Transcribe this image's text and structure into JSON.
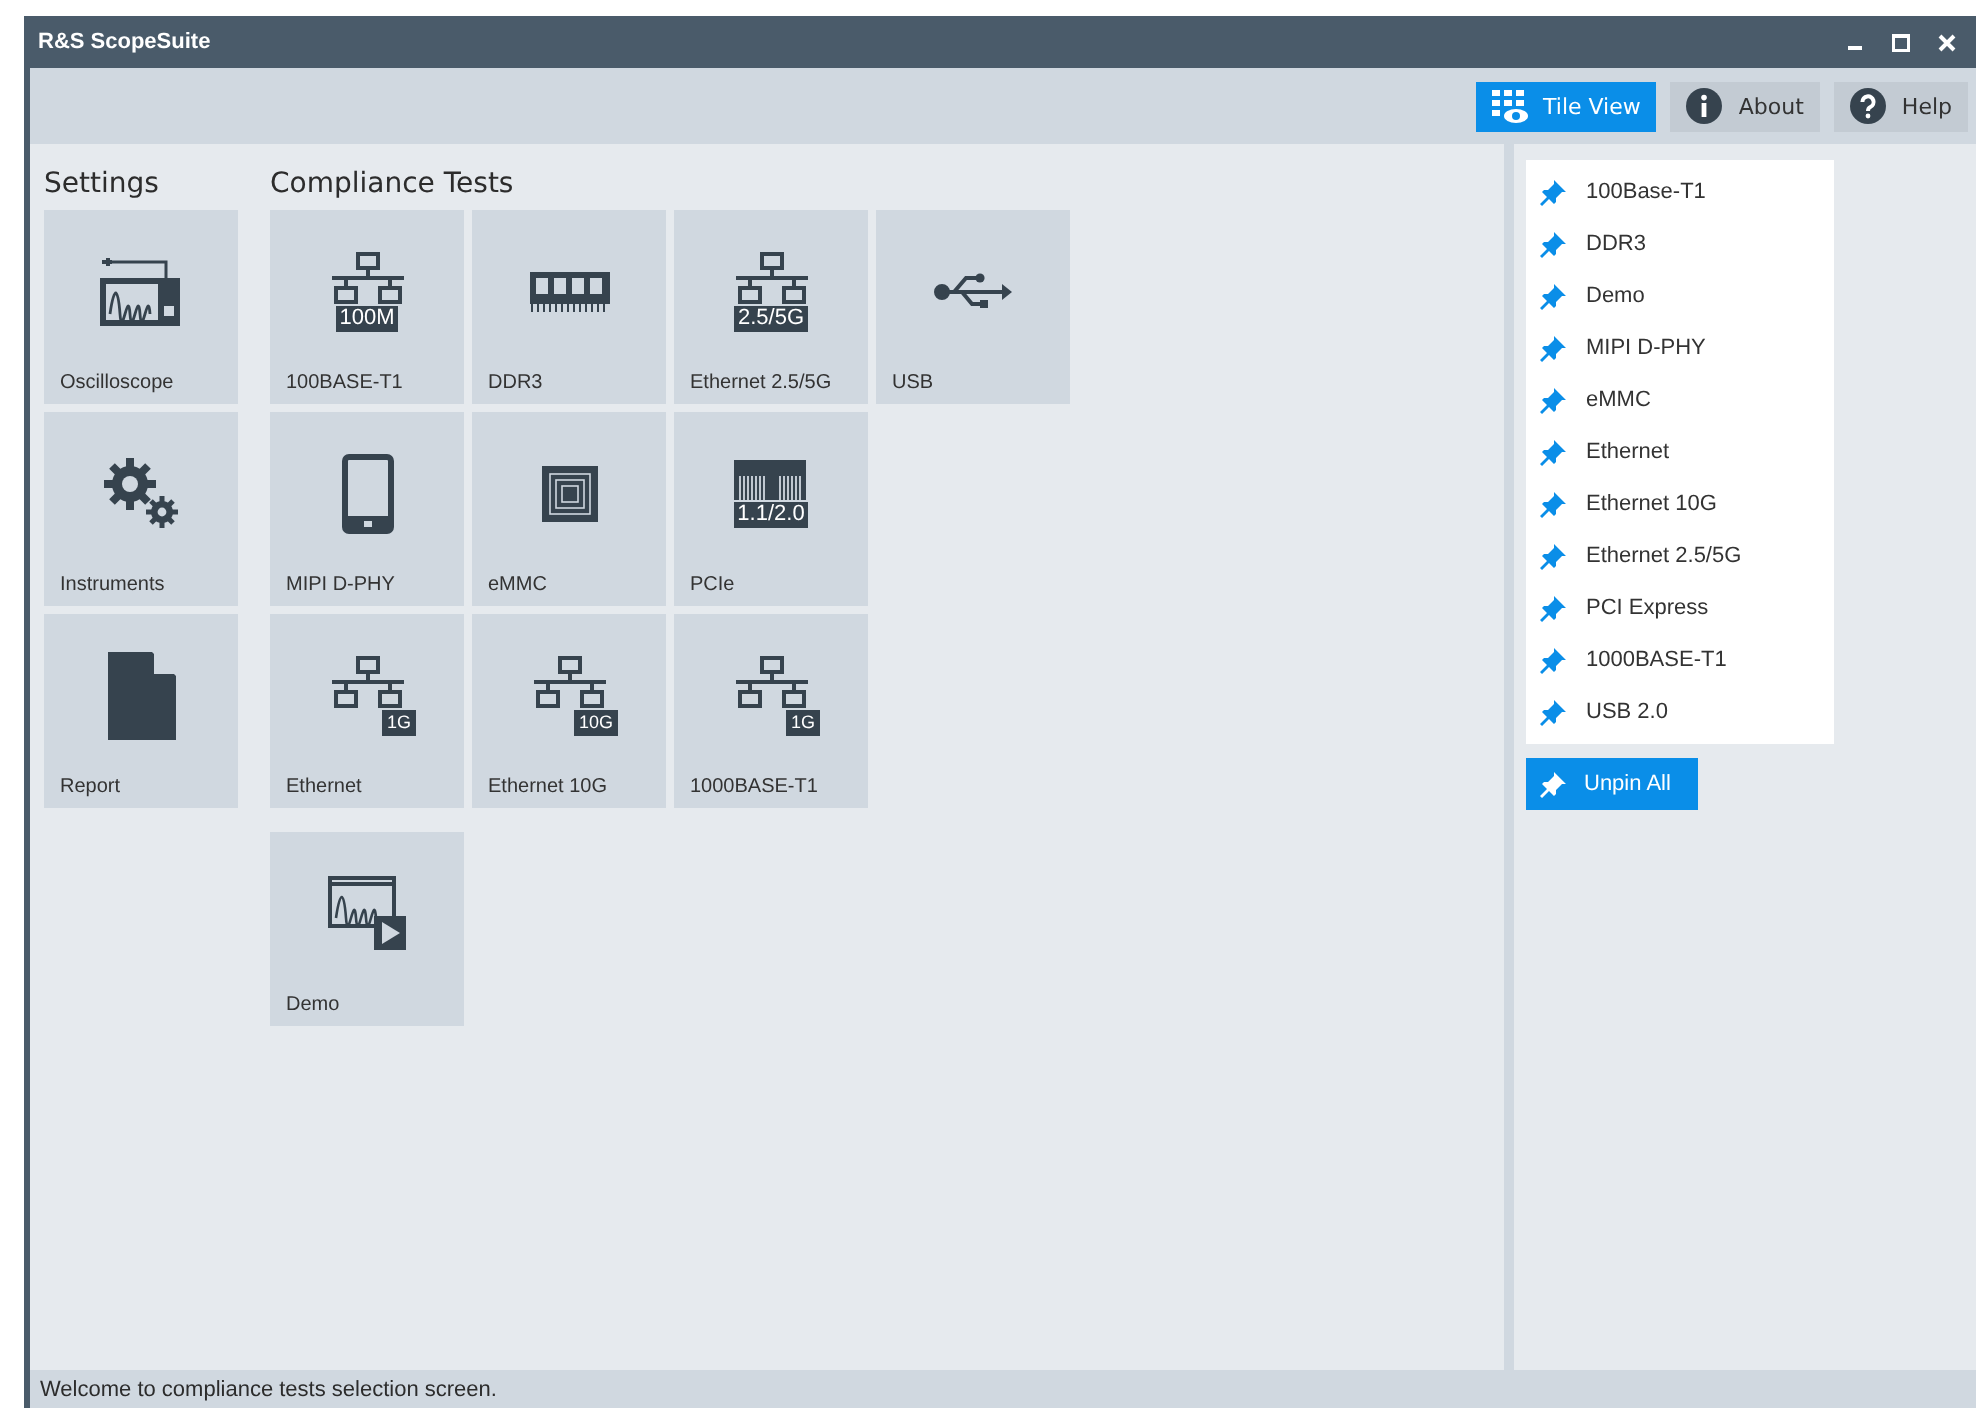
{
  "window": {
    "title": "R&S ScopeSuite"
  },
  "toolbar": [
    {
      "label": "Tile View",
      "kind": "tiles",
      "selected": true
    },
    {
      "label": "About",
      "kind": "info",
      "selected": false
    },
    {
      "label": "Help",
      "kind": "help",
      "selected": false
    }
  ],
  "settings": {
    "heading": "Settings",
    "tiles": [
      {
        "label": "Oscilloscope",
        "kind": "scope"
      },
      {
        "label": "Instruments",
        "kind": "gears"
      },
      {
        "label": "Report",
        "kind": "document"
      }
    ]
  },
  "compliance": {
    "heading": "Compliance Tests",
    "rows": [
      [
        {
          "label": "100BASE-T1",
          "kind": "network",
          "badge": "100M"
        },
        {
          "label": "DDR3",
          "kind": "memory"
        },
        {
          "label": "Ethernet 2.5/5G",
          "kind": "network",
          "badge": "2.5/5G"
        },
        {
          "label": "USB",
          "kind": "usb"
        }
      ],
      [
        {
          "label": "MIPI D-PHY",
          "kind": "phone"
        },
        {
          "label": "eMMC",
          "kind": "chip"
        },
        {
          "label": "PCIe",
          "kind": "pcie",
          "badge": "1.1/2.0"
        }
      ],
      [
        {
          "label": "Ethernet",
          "kind": "network",
          "badge": "1G"
        },
        {
          "label": "Ethernet 10G",
          "kind": "network",
          "badge": "10G"
        },
        {
          "label": "1000BASE-T1",
          "kind": "network",
          "badge": "1G"
        }
      ],
      [
        {
          "label": "Demo",
          "kind": "demo"
        }
      ]
    ]
  },
  "pinned": [
    "100Base-T1",
    "DDR3",
    "Demo",
    "MIPI D-PHY",
    "eMMC",
    "Ethernet",
    "Ethernet 10G",
    "Ethernet 2.5/5G",
    "PCI Express",
    "1000BASE-T1",
    "USB 2.0"
  ],
  "unpin_button": "Unpin All",
  "status_bar": "Welcome to compliance tests selection screen."
}
